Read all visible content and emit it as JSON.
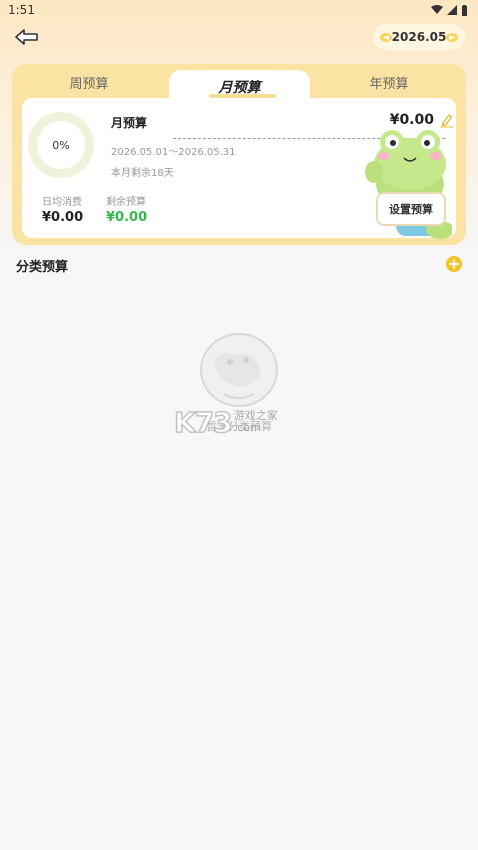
{
  "status_bar": {
    "time": "1:51"
  },
  "header": {
    "period": "2026.05"
  },
  "tabs": {
    "week": "周预算",
    "month": "月预算",
    "year": "年预算"
  },
  "budget": {
    "progress_text": "0%",
    "progress": 0,
    "title": "月预算",
    "amount": "¥0.00",
    "date_range": "2026.05.01～2026.05.31",
    "days_left": "本月剩余18天",
    "daily_label": "日均消费",
    "daily_value": "¥0.00",
    "remaining_label": "剩余预算",
    "remaining_value": "¥0.00",
    "set_button": "设置预算"
  },
  "category": {
    "title": "分类预算"
  },
  "empty": {
    "text": "暂无分类预算"
  },
  "watermark": {
    "brand": "K73",
    "line1": "游戏之家",
    "line2": ".com"
  },
  "colors": {
    "accent_yellow": "#f5c322",
    "card_bg": "#fbe3a3",
    "remaining_green": "#33b84b",
    "ring_track": "#f0f2dc"
  },
  "icons": [
    "back-arrow-icon",
    "prev-arrow-icon",
    "next-arrow-icon",
    "edit-pencil-icon",
    "add-icon",
    "frog-mascot",
    "empty-planet-illustration"
  ]
}
